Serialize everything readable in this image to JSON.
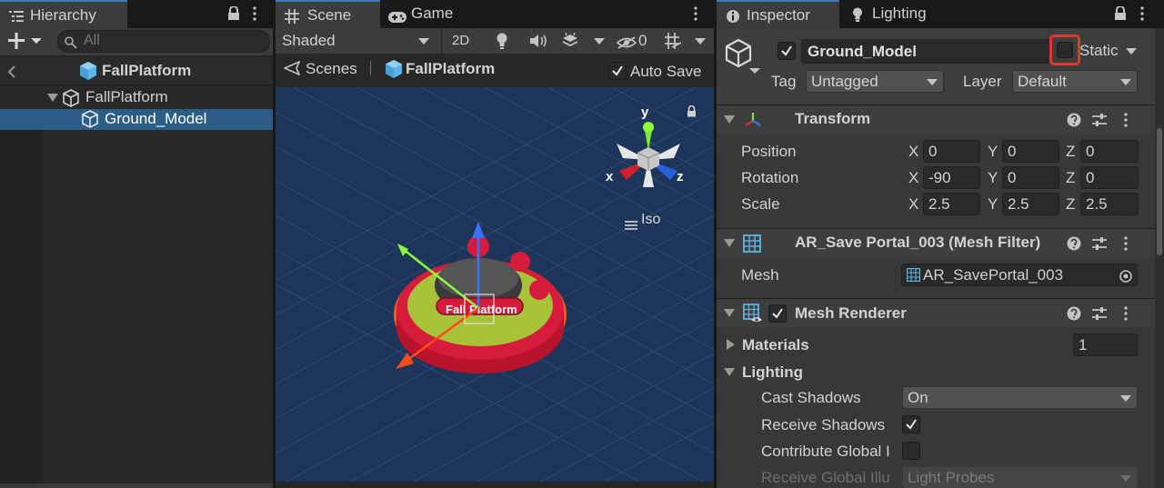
{
  "hierarchy": {
    "tab_label": "Hierarchy",
    "search_placeholder": "All",
    "scene_name": "FallPlatform",
    "items": [
      {
        "label": "FallPlatform"
      },
      {
        "label": "Ground_Model"
      }
    ]
  },
  "scene": {
    "tabs": [
      {
        "label": "Scene"
      },
      {
        "label": "Game"
      }
    ],
    "shading_mode": "Shaded",
    "mode_2d": "2D",
    "hidden_count": "0",
    "breadcrumb": {
      "root": "Scenes",
      "current": "FallPlatform"
    },
    "auto_save_label": "Auto Save",
    "auto_save_checked": true,
    "gizmo": {
      "x": "x",
      "y": "y",
      "z": "z",
      "projection": "Iso"
    },
    "model_label": "Fall Platform"
  },
  "inspector": {
    "tabs": [
      {
        "label": "Inspector"
      },
      {
        "label": "Lighting"
      }
    ],
    "object_name": "Ground_Model",
    "active_checked": true,
    "static_label": "Static",
    "tag_label": "Tag",
    "tag_value": "Untagged",
    "layer_label": "Layer",
    "layer_value": "Default",
    "transform": {
      "title": "Transform",
      "rows": [
        {
          "label": "Position",
          "x": "0",
          "y": "0",
          "z": "0"
        },
        {
          "label": "Rotation",
          "x": "-90",
          "y": "0",
          "z": "0"
        },
        {
          "label": "Scale",
          "x": "2.5",
          "y": "2.5",
          "z": "2.5"
        }
      ],
      "axis_x": "X",
      "axis_y": "Y",
      "axis_z": "Z"
    },
    "mesh_filter": {
      "title": "AR_Save Portal_003 (Mesh Filter)",
      "mesh_label": "Mesh",
      "mesh_value": "AR_SavePortal_003"
    },
    "mesh_renderer": {
      "title": "Mesh Renderer",
      "materials_label": "Materials",
      "materials_count": "1",
      "lighting_label": "Lighting",
      "cast_shadows_label": "Cast Shadows",
      "cast_shadows_value": "On",
      "receive_shadows_label": "Receive Shadows",
      "contribute_gi_label": "Contribute Global I",
      "receive_gi_label": "Receive Global Illu",
      "receive_gi_value": "Light Probes"
    }
  },
  "colors": {
    "accent_blue": "#3a79bb",
    "selection": "#2c5d87",
    "highlight_red": "#e03a2e"
  }
}
